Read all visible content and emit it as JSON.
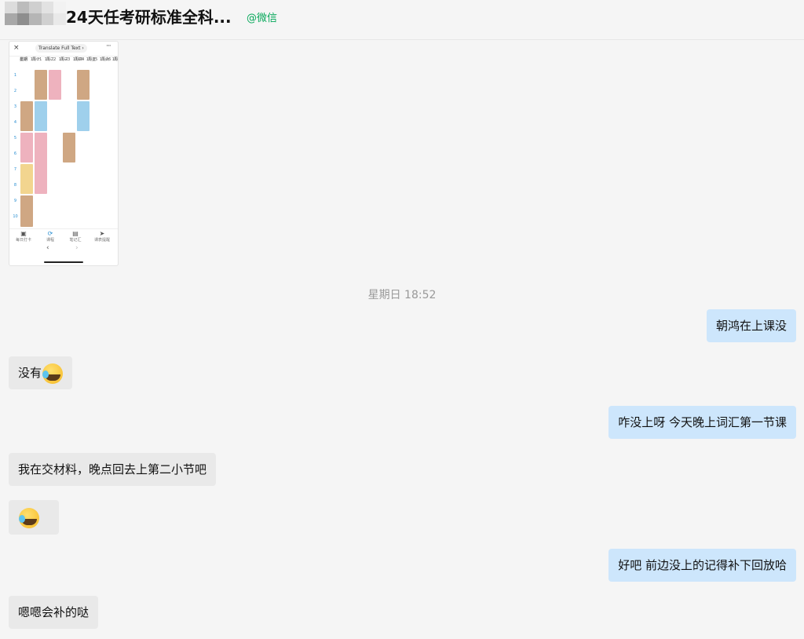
{
  "header": {
    "title": "24天任考研标准全科...",
    "tag": "@微信"
  },
  "image_message": {
    "close_glyph": "×",
    "translate_label": "Translate Full Text ›",
    "more_glyph": "···",
    "day_header": [
      {
        "day": "星期",
        "date": "日期"
      },
      {
        "day": "周一",
        "date": "11-21"
      },
      {
        "day": "周二",
        "date": "11-22"
      },
      {
        "day": "周三",
        "date": "11-23"
      },
      {
        "day": "周四",
        "date": "11-24"
      },
      {
        "day": "周五",
        "date": "11-25"
      },
      {
        "day": "周六",
        "date": "11-26"
      },
      {
        "day": "周日",
        "date": "11-21"
      }
    ],
    "periods": [
      "1",
      "2",
      "3",
      "4",
      "5",
      "6",
      "7",
      "8",
      "9",
      "10"
    ],
    "bottom_tabs": [
      "每日打卡",
      "课程",
      "笔记汇",
      "课表提醒"
    ],
    "nav_back": "‹",
    "nav_forward": "›"
  },
  "messages": {
    "timestamp": "星期日 18:52",
    "m1": "朝鸿在上课没",
    "m2": "没有",
    "m3": "咋没上呀 今天晚上词汇第一节课",
    "m4": "我在交材料，晚点回去上第二小节吧",
    "m5": "",
    "m6": "好吧 前边没上的记得补下回放哈",
    "m7": "嗯嗯会补的哒"
  },
  "colors": {
    "background": "#f5f5f5",
    "incoming_bubble": "#e9e9e9",
    "outgoing_bubble": "#cde6fc",
    "wechat_tag": "#07a85a"
  }
}
